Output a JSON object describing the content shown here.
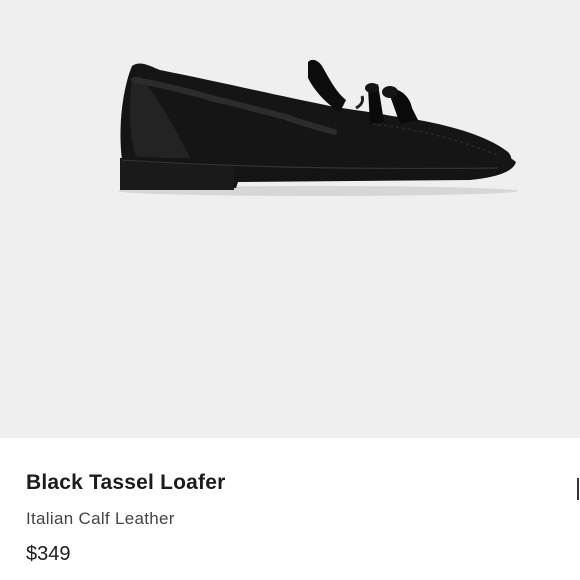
{
  "product": {
    "title": "Black Tassel Loafer",
    "material": "Italian Calf Leather",
    "price": "$349",
    "image_name": "black-tassel-loafer-image"
  },
  "colors": {
    "image_background": "#efefef",
    "card_background": "#ffffff",
    "title_text": "#1c1c1c",
    "subtitle_text": "#444444",
    "shoe": "#111111"
  }
}
